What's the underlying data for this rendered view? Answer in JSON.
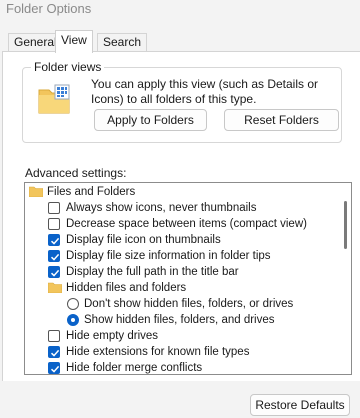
{
  "window": {
    "title": "Folder Options"
  },
  "tabs": [
    {
      "label": "General"
    },
    {
      "label": "View"
    },
    {
      "label": "Search"
    }
  ],
  "folder_views": {
    "legend": "Folder views",
    "description": "You can apply this view (such as Details or Icons) to all folders of this type.",
    "apply_label": "Apply to Folders",
    "reset_label": "Reset Folders",
    "icon": "folder-grid-icon"
  },
  "advanced": {
    "label": "Advanced settings:",
    "items": [
      {
        "kind": "folder",
        "label": "Files and Folders",
        "icon": "folder-icon"
      },
      {
        "kind": "checkbox",
        "label": "Always show icons, never thumbnails",
        "checked": false
      },
      {
        "kind": "checkbox",
        "label": "Decrease space between items (compact view)",
        "checked": false
      },
      {
        "kind": "checkbox",
        "label": "Display file icon on thumbnails",
        "checked": true
      },
      {
        "kind": "checkbox",
        "label": "Display file size information in folder tips",
        "checked": true
      },
      {
        "kind": "checkbox",
        "label": "Display the full path in the title bar",
        "checked": true
      },
      {
        "kind": "folder",
        "label": "Hidden files and folders",
        "icon": "folder-icon"
      },
      {
        "kind": "radio",
        "label": "Don't show hidden files, folders, or drives",
        "checked": false
      },
      {
        "kind": "radio",
        "label": "Show hidden files, folders, and drives",
        "checked": true
      },
      {
        "kind": "checkbox",
        "label": "Hide empty drives",
        "checked": false
      },
      {
        "kind": "checkbox",
        "label": "Hide extensions for known file types",
        "checked": true
      },
      {
        "kind": "checkbox",
        "label": "Hide folder merge conflicts",
        "checked": true
      }
    ]
  },
  "footer": {
    "restore_label": "Restore Defaults"
  },
  "colors": {
    "accent": "#0a62c9",
    "folder": "#f2c55c"
  }
}
